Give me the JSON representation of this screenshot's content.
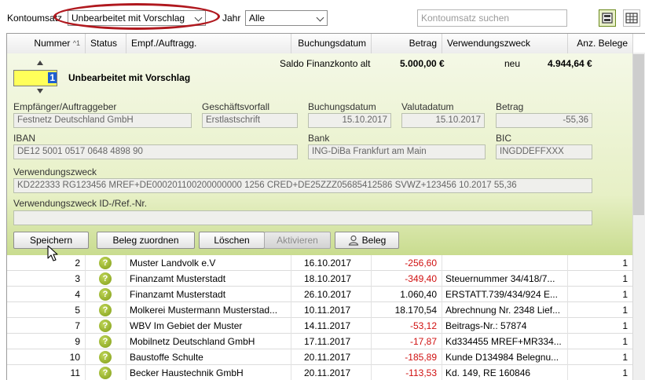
{
  "toolbar": {
    "kontoumsatz_label": "Kontoumsatz",
    "kontoumsatz_value": "Unbearbeitet mit Vorschlag",
    "jahr_label": "Jahr",
    "jahr_value": "Alle",
    "search_placeholder": "Kontoumsatz suchen",
    "highlight_color": "#b0181e"
  },
  "columns": {
    "nummer": "Nummer",
    "sort_indicator": "^1",
    "status": "Status",
    "empf": "Empf./Auftragg.",
    "buchungsdatum": "Buchungsdatum",
    "betrag": "Betrag",
    "verwendungszweck": "Verwendungszweck",
    "anz_belege": "Anz. Belege"
  },
  "detail": {
    "saldo_label": "Saldo Finanzkonto alt",
    "saldo_value": "5.000,00 €",
    "neu_label": "neu",
    "neu_value": "4.944,64 €",
    "number_value": "1",
    "state_label": "Unbearbeitet mit Vorschlag",
    "empfaenger_label": "Empfänger/Auftraggeber",
    "empfaenger_value": "Festnetz Deutschland GmbH",
    "geschaeftsvorfall_label": "Geschäftsvorfall",
    "geschaeftsvorfall_value": "Erstlastschrift",
    "buchungsdatum_label": "Buchungsdatum",
    "buchungsdatum_value": "15.10.2017",
    "valutadatum_label": "Valutadatum",
    "valutadatum_value": "15.10.2017",
    "betrag_label": "Betrag",
    "betrag_value": "-55,36",
    "iban_label": "IBAN",
    "iban_value": "DE12 5001 0517 0648 4898 90",
    "bank_label": "Bank",
    "bank_value": "ING-DiBa Frankfurt am Main",
    "bic_label": "BIC",
    "bic_value": "INGDDEFFXXX",
    "verwendungszweck_label": "Verwendungszweck",
    "verwendungszweck_value": "KD222333 RG123456 MREF+DE000201100200000000 1256 CRED+DE25ZZZ05685412586 SVWZ+123456 10.2017 55,36",
    "ref_label": "Verwendungszweck ID-/Ref.-Nr.",
    "ref_value": "",
    "buttons": {
      "speichern": "Speichern",
      "beleg_zuordnen": "Beleg zuordnen",
      "loeschen": "Löschen",
      "aktivieren": "Aktivieren",
      "beleg": "Beleg"
    }
  },
  "rows": [
    {
      "nummer": "2",
      "status": "?",
      "empf": "Muster Landvolk e.V",
      "datum": "16.10.2017",
      "betrag": "-256,60",
      "neg": true,
      "zweck": "",
      "belege": "1"
    },
    {
      "nummer": "3",
      "status": "?",
      "empf": "Finanzamt Musterstadt",
      "datum": "18.10.2017",
      "betrag": "-349,40",
      "neg": true,
      "zweck": "Steuernummer 34/418/7...",
      "belege": "1"
    },
    {
      "nummer": "4",
      "status": "?",
      "empf": "Finanzamt Musterstadt",
      "datum": "26.10.2017",
      "betrag": "1.060,40",
      "neg": false,
      "zweck": "ERSTATT.739/434/924 E...",
      "belege": "1"
    },
    {
      "nummer": "5",
      "status": "?",
      "empf": "Molkerei Mustermann Musterstad...",
      "datum": "10.11.2017",
      "betrag": "18.170,54",
      "neg": false,
      "zweck": "Abrechnung Nr. 2348 Lief...",
      "belege": "1"
    },
    {
      "nummer": "7",
      "status": "?",
      "empf": "WBV Im Gebiet der Muster",
      "datum": "14.11.2017",
      "betrag": "-53,12",
      "neg": true,
      "zweck": "Beitrags-Nr.: 57874",
      "belege": "1"
    },
    {
      "nummer": "9",
      "status": "?",
      "empf": "Mobilnetz Deutschland GmbH",
      "datum": "17.11.2017",
      "betrag": "-17,87",
      "neg": true,
      "zweck": "Kd334455 MREF+MR334...",
      "belege": "1"
    },
    {
      "nummer": "10",
      "status": "?",
      "empf": "Baustoffe Schulte",
      "datum": "20.11.2017",
      "betrag": "-185,89",
      "neg": true,
      "zweck": "Kunde D134984 Belegnu...",
      "belege": "1"
    },
    {
      "nummer": "11",
      "status": "?",
      "empf": "Becker Haustechnik GmbH",
      "datum": "20.11.2017",
      "betrag": "-113,53",
      "neg": true,
      "zweck": "Kd. 149, RE 160846",
      "belege": "1"
    }
  ]
}
